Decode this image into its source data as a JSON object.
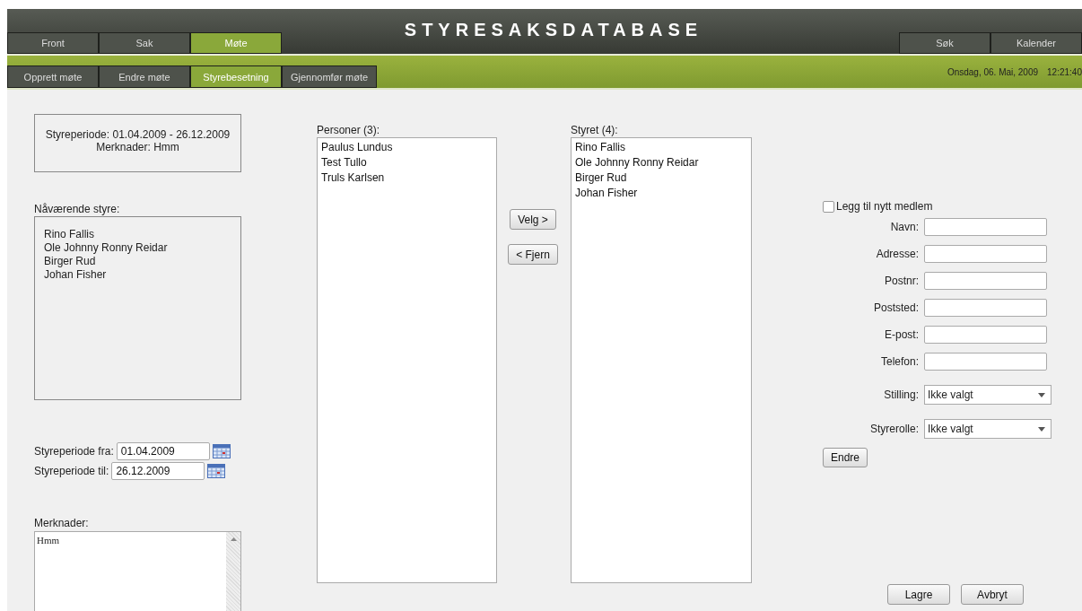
{
  "app": {
    "title": "STYRESAKSDATABASE"
  },
  "main_tabs": [
    {
      "label": "Front",
      "selected": false
    },
    {
      "label": "Sak",
      "selected": false
    },
    {
      "label": "Møte",
      "selected": true
    }
  ],
  "right_tabs": [
    {
      "label": "Søk",
      "selected": false
    },
    {
      "label": "Kalender",
      "selected": false
    }
  ],
  "sub_tabs": [
    {
      "label": "Opprett møte",
      "selected": false
    },
    {
      "label": "Endre møte",
      "selected": false
    },
    {
      "label": "Styrebesetning",
      "selected": true
    },
    {
      "label": "Gjennomfør møte",
      "selected": false
    }
  ],
  "datetime": {
    "date": "Onsdag, 06. Mai, 2009",
    "time": "12:21:40"
  },
  "summary": {
    "period": "Styreperiode: 01.04.2009 - 26.12.2009",
    "remarks": "Merknader: Hmm"
  },
  "current_board": {
    "label": "Nåværende styre:",
    "members": [
      "Rino Fallis",
      "Ole Johnny Ronny Reidar",
      "Birger Rud",
      "Johan Fisher"
    ]
  },
  "period_fields": [
    {
      "label": "Styreperiode fra:",
      "value": "01.04.2009"
    },
    {
      "label": "Styreperiode til:",
      "value": "26.12.2009"
    }
  ],
  "remarks": {
    "label": "Merknader:",
    "value": "Hmm"
  },
  "persons": {
    "label": "Personer (3):",
    "items": [
      "Paulus Lundus",
      "Test Tullo",
      "Truls Karlsen"
    ]
  },
  "move_buttons": [
    "Velg >",
    "< Fjern"
  ],
  "board": {
    "label": "Styret (4):",
    "items": [
      "Rino Fallis",
      "Ole Johnny Ronny Reidar",
      "Birger Rud",
      "Johan Fisher"
    ]
  },
  "new_member": {
    "label": "Legg til nytt medlem",
    "checked": false
  },
  "fields": [
    {
      "label": "Navn:",
      "kind": "text"
    },
    {
      "label": "Adresse:",
      "kind": "text"
    },
    {
      "label": "Postnr:",
      "kind": "text"
    },
    {
      "label": "Poststed:",
      "kind": "text"
    },
    {
      "label": "E-post:",
      "kind": "text"
    },
    {
      "label": "Telefon:",
      "kind": "text"
    },
    {
      "label": "Stilling:",
      "kind": "select",
      "value": "Ikke valgt"
    },
    {
      "label": "Styrerolle:",
      "kind": "select",
      "value": "Ikke valgt"
    }
  ],
  "edit_button": "Endre",
  "actions": [
    "Lagre",
    "Avbryt"
  ]
}
